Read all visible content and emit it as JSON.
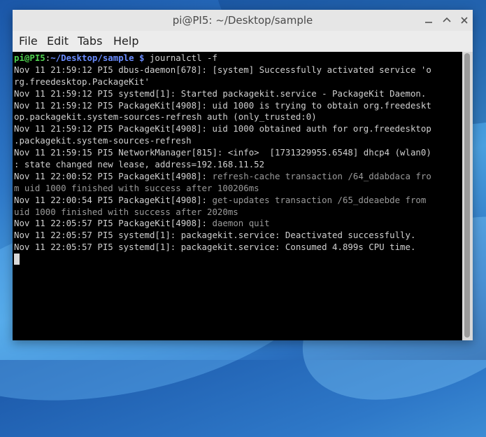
{
  "window": {
    "title": "pi@PI5: ~/Desktop/sample"
  },
  "menu": [
    "File",
    "Edit",
    "Tabs",
    "Help"
  ],
  "prompt": {
    "user_host": "pi@PI5",
    "colon": ":",
    "path": "~/Desktop/sample",
    "dollar": " $",
    "command": " journalctl -f"
  },
  "log": [
    "Nov 11 21:59:12 PI5 dbus-daemon[678]: [system] Successfully activated service 'o",
    "rg.freedesktop.PackageKit'",
    "Nov 11 21:59:12 PI5 systemd[1]: Started packagekit.service - PackageKit Daemon.",
    "Nov 11 21:59:12 PI5 PackageKit[4908]: uid 1000 is trying to obtain org.freedeskt",
    "op.packagekit.system-sources-refresh auth (only_trusted:0)",
    "Nov 11 21:59:12 PI5 PackageKit[4908]: uid 1000 obtained auth for org.freedesktop",
    ".packagekit.system-sources-refresh",
    "Nov 11 21:59:15 PI5 NetworkManager[815]: <info>  [1731329955.6548] dhcp4 (wlan0)",
    ": state changed new lease, address=192.168.11.52"
  ],
  "log_dim": [
    {
      "prefix": "Nov 11 22:00:52 PI5 PackageKit[4908]: ",
      "msg": "refresh-cache transaction /64_ddabdaca fro"
    },
    {
      "prefix": "",
      "msg": "m uid 1000 finished with success after 100206ms"
    },
    {
      "prefix": "Nov 11 22:00:54 PI5 PackageKit[4908]: ",
      "msg": "get-updates transaction /65_ddeaebde from"
    },
    {
      "prefix": "",
      "msg": "uid 1000 finished with success after 2020ms"
    },
    {
      "prefix": "Nov 11 22:05:57 PI5 PackageKit[4908]: ",
      "msg": "daemon quit"
    }
  ],
  "log_tail": [
    "Nov 11 22:05:57 PI5 systemd[1]: packagekit.service: Deactivated successfully.",
    "Nov 11 22:05:57 PI5 systemd[1]: packagekit.service: Consumed 4.899s CPU time."
  ]
}
